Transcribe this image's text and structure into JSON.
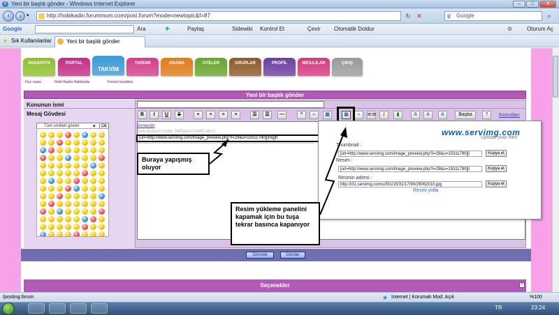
{
  "window": {
    "title": "Yeni bir başlık gönder - Windows Internet Explorer",
    "controls": [
      "–",
      "□",
      "X"
    ]
  },
  "addressbar": {
    "url": "http://hobikadin.forummum.com/post.forum?mode=newtopic&f=87",
    "search_placeholder": "Google"
  },
  "google_toolbar": {
    "logo": "Google",
    "items": [
      "Ara",
      "Paylaş",
      "Sidewiki",
      "Kontrol Et",
      "Çevir",
      "Otomatik Doldur",
      "Oturum Aç"
    ]
  },
  "favbar": {
    "favorites": "Sık Kullanılanlar",
    "tab_title": "Yeni bir başlık gönder"
  },
  "site_nav": {
    "tabs": [
      {
        "label": "ANASAYFA",
        "color": "#8fbf2e"
      },
      {
        "label": "PORTAL",
        "color": "#c42e86"
      },
      {
        "label": "TAKVİM",
        "color": "#3b9ad6"
      },
      {
        "label": "YARDIM",
        "color": "#d53d8a"
      },
      {
        "label": "ARAMA",
        "color": "#e07a1a"
      },
      {
        "label": "ÜYELER",
        "color": "#68a52a"
      },
      {
        "label": "GRUPLAR",
        "color": "#8b5a2b"
      },
      {
        "label": "PROFİL",
        "color": "#6b3fa0"
      },
      {
        "label": "MESAJLAR",
        "color": "#d6397d"
      },
      {
        "label": "ÇIKIŞ",
        "color": "#9a9a9a"
      }
    ],
    "active": "TAKVİM",
    "sub_links": [
      "Üye oyası",
      "Hobi Kadın Hakkında",
      "Forum kuralları"
    ]
  },
  "form": {
    "heading": "Yeni bir başlık gönder",
    "subject_label": "Konunun ismi",
    "body_label": "Mesaj Gövdesi",
    "smiley_select": "Tüm smilleri göster",
    "smiley_ok": "Ok",
    "toolbar_more": "Başka",
    "toolbar_comments": "Komutları",
    "settings_link": "Seçenekleri",
    "pasted_line": "Sola dıştayın modu: [left]yazın [/left] (alt+l)",
    "editor_text": "[url=http://www.servimg.com/image_preview.php?i=29&u=15311790][img]h",
    "preview_button": "Görmek",
    "send_button": "Gönder",
    "section_options": "Seçenekler"
  },
  "upload_panel": {
    "brand": "www.servimg.com",
    "tagline": "Upload your files",
    "fields": [
      {
        "label": "Thumbnail :",
        "value": "[url=http://www.servimg.com/image_preview.php?i=29&u=15311790][i",
        "button": "Kopya et"
      },
      {
        "label": "Resim :",
        "value": "[url=http://www.servimg.com/image_preview.php?i=29&u=15311790][i",
        "button": "Kopya et"
      },
      {
        "label": "Resmin adresi :",
        "value": "http://i31.servimg.com/u/f31/15/31/17/90/29062010.jpg",
        "button": "Kopya et"
      }
    ],
    "upload_link": "Resmi yolla"
  },
  "callouts": {
    "left": "Buraya yapışmış oluyor",
    "right": "Resim yükleme panelini kapamak için bu tuşa tekrar basınca kapanıyor"
  },
  "statusbar": {
    "path": "/posting.forum",
    "zone": "Internet | Korumalı Mod: Açık",
    "zoom": "%100"
  },
  "taskbar": {
    "lang": "TR",
    "time": "23:24"
  }
}
